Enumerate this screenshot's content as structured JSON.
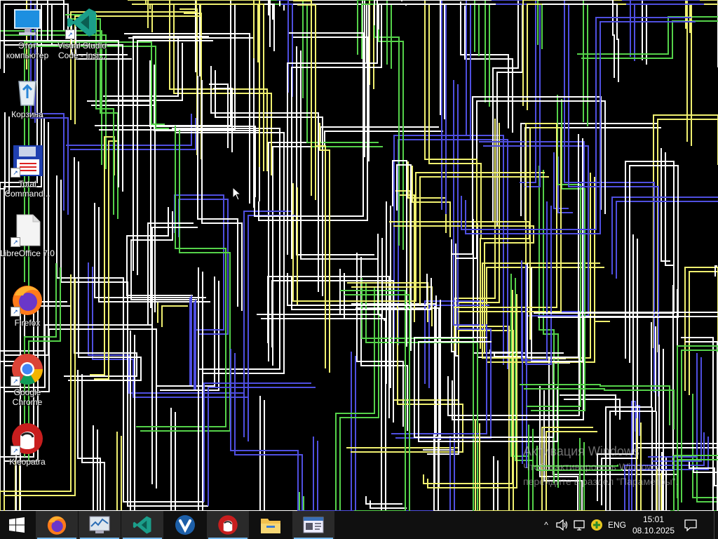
{
  "desktop": {
    "icons": [
      {
        "label": "Этот компьютер",
        "icon": "computer-icon"
      },
      {
        "label": "Visual Studio Code - Insi...",
        "icon": "vscode-icon"
      },
      {
        "label": "Корзина",
        "icon": "recycle-bin-icon"
      },
      {
        "label": "Total Command...",
        "icon": "total-commander-icon"
      },
      {
        "label": "LibreOffice 7.0",
        "icon": "libreoffice-icon"
      },
      {
        "label": "Firefox",
        "icon": "firefox-icon"
      },
      {
        "label": "Google Chrome",
        "icon": "chrome-icon"
      },
      {
        "label": "Kleopatra",
        "icon": "kleopatra-icon"
      }
    ]
  },
  "watermark": {
    "title": "Активация Windows",
    "line1": "Чтобы активировать Windows,",
    "line2": "перейдите в раздел \"Параметры\"."
  },
  "taskbar": {
    "start": "start-icon",
    "pinned": [
      "firefox-icon",
      "system-monitor-icon",
      "vscode-icon",
      "vivaldi-icon",
      "kleopatra-icon",
      "file-explorer-icon",
      "network-window-icon"
    ],
    "tray": {
      "chevron": "^",
      "language": "ENG",
      "time": "15:01",
      "date": "08.10.2025"
    }
  },
  "colors": {
    "wallpaper_bg": "#000000",
    "line_white": "#ffffff",
    "line_green": "#55d24a",
    "line_blue": "#4f4fe0",
    "line_yellow": "#f0f070",
    "taskbar_bg": "#101010"
  }
}
